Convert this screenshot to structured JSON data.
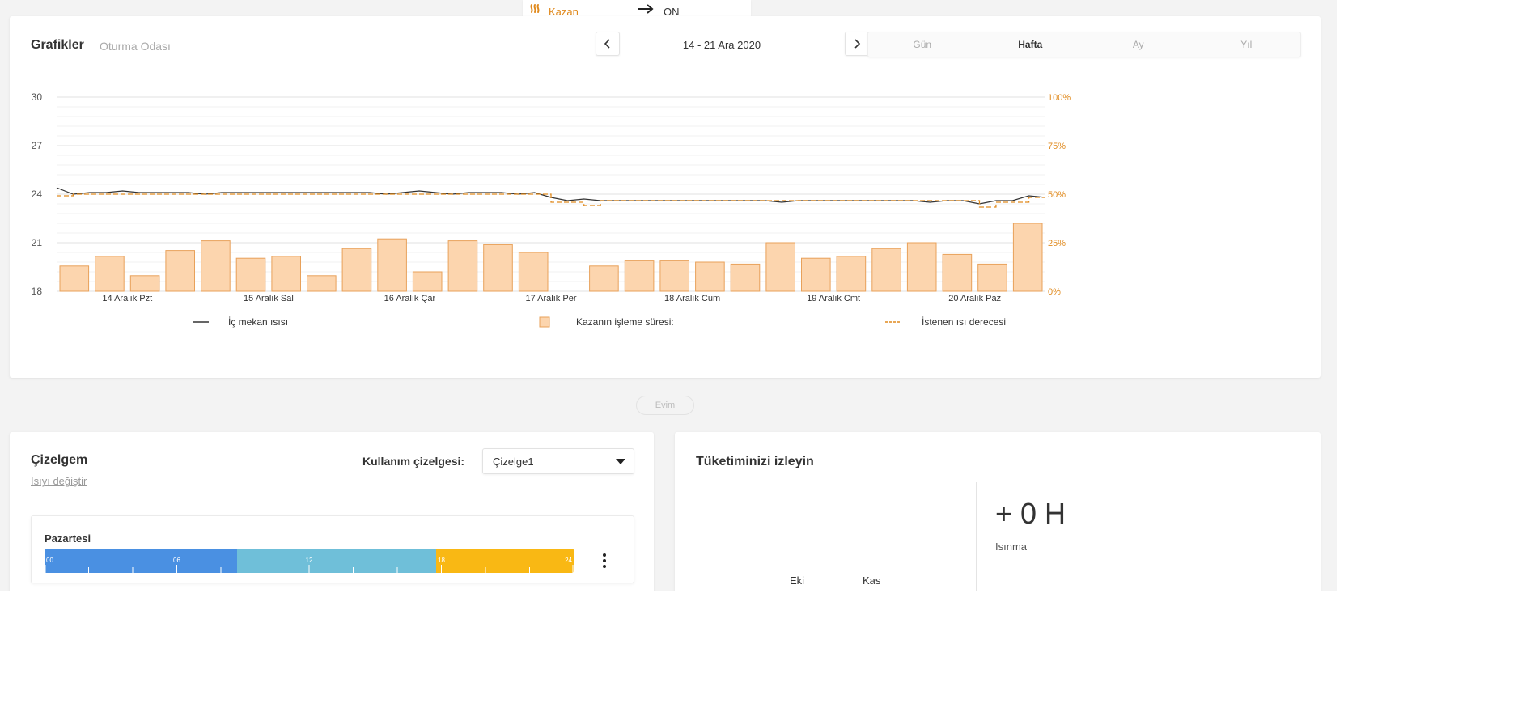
{
  "notification": {
    "label": "Kazan",
    "value": "ON"
  },
  "graphs": {
    "title": "Grafikler",
    "room": "Oturma Odası",
    "date_range": "14 - 21 Ara 2020",
    "tabs": [
      "Gün",
      "Hafta",
      "Ay",
      "Yıl"
    ],
    "active_tab": "Hafta"
  },
  "chart_data": {
    "type": "line",
    "x_labels": [
      "14 Aralık Pzt",
      "15 Aralık Sal",
      "16 Aralık Çar",
      "17 Aralık Per",
      "18 Aralık Cum",
      "19 Aralık Cmt",
      "20 Aralık Paz"
    ],
    "y_left_ticks": [
      "30",
      "27",
      "24",
      "21",
      "18"
    ],
    "y_right_ticks": [
      "100%",
      "75%",
      "50%",
      "25%",
      "0%"
    ],
    "ylim_left": [
      18,
      30
    ],
    "ylim_right": [
      0,
      100
    ],
    "grid": true,
    "legend_position": "bottom",
    "colors": {
      "indoor": "#333333",
      "boiler_fill": "#fcd5ae",
      "boiler_stroke": "#e8a15a",
      "target": "#e08a1e",
      "right_axis": "#e08a1e"
    },
    "series": [
      {
        "name": "İç mekan ısısı",
        "type": "line",
        "axis": "left",
        "values": [
          24.4,
          24.0,
          24.1,
          24.1,
          24.2,
          24.1,
          24.1,
          24.1,
          24.1,
          24.0,
          24.1,
          24.1,
          24.1,
          24.1,
          24.1,
          24.1,
          24.1,
          24.1,
          24.1,
          24.1,
          24.0,
          24.1,
          24.2,
          24.1,
          24.0,
          24.1,
          24.1,
          24.1,
          24.0,
          24.1,
          23.8,
          23.6,
          23.7,
          23.6,
          23.6,
          23.6,
          23.6,
          23.6,
          23.6,
          23.6,
          23.6,
          23.6,
          23.6,
          23.6,
          23.5,
          23.6,
          23.6,
          23.6,
          23.6,
          23.6,
          23.6,
          23.6,
          23.6,
          23.5,
          23.6,
          23.6,
          23.4,
          23.6,
          23.6,
          23.9,
          23.8
        ]
      },
      {
        "name": "Kazanın işleme süresi:",
        "type": "bar",
        "axis": "right",
        "values": [
          13,
          18,
          8,
          21,
          26,
          17,
          18,
          8,
          22,
          27,
          10,
          26,
          24,
          20,
          0,
          13,
          16,
          16,
          15,
          14,
          25,
          17,
          18,
          22,
          25,
          19,
          14,
          35
        ]
      },
      {
        "name": "İstenen ısı derecesi",
        "type": "line",
        "axis": "left",
        "style": "dashed",
        "values": [
          23.9,
          24.0,
          24.0,
          24.0,
          24.0,
          24.0,
          24.0,
          24.0,
          24.0,
          24.0,
          24.0,
          24.0,
          24.0,
          24.0,
          24.0,
          24.0,
          24.0,
          24.0,
          24.0,
          24.0,
          24.0,
          24.0,
          24.0,
          24.0,
          24.0,
          24.0,
          24.0,
          24.0,
          24.0,
          24.0,
          23.5,
          23.5,
          23.3,
          23.6,
          23.6,
          23.6,
          23.6,
          23.6,
          23.6,
          23.6,
          23.6,
          23.6,
          23.6,
          23.6,
          23.6,
          23.6,
          23.6,
          23.6,
          23.6,
          23.6,
          23.6,
          23.6,
          23.6,
          23.6,
          23.6,
          23.6,
          23.2,
          23.5,
          23.5,
          23.8,
          23.8
        ]
      }
    ]
  },
  "divider": {
    "label": "Evim"
  },
  "schedule": {
    "title": "Çizelgem",
    "link": "Isıyı değiştir",
    "usage_label": "Kullanım çizelgesi:",
    "selected": "Çizelge1",
    "day": "Pazartesi",
    "hour_labels": [
      "00",
      "06",
      "12",
      "18",
      "24"
    ],
    "segments": [
      {
        "from": 0,
        "to": 8.75,
        "color": "#4a90e2"
      },
      {
        "from": 8.75,
        "to": 17.75,
        "color": "#6fbfd9"
      },
      {
        "from": 17.75,
        "to": 24,
        "color": "#f9b814"
      }
    ]
  },
  "consumption": {
    "title": "Tüketiminizi izleyin",
    "months": [
      "Eki",
      "Kas"
    ],
    "value": "+ 0 H",
    "label": "Isınma"
  }
}
